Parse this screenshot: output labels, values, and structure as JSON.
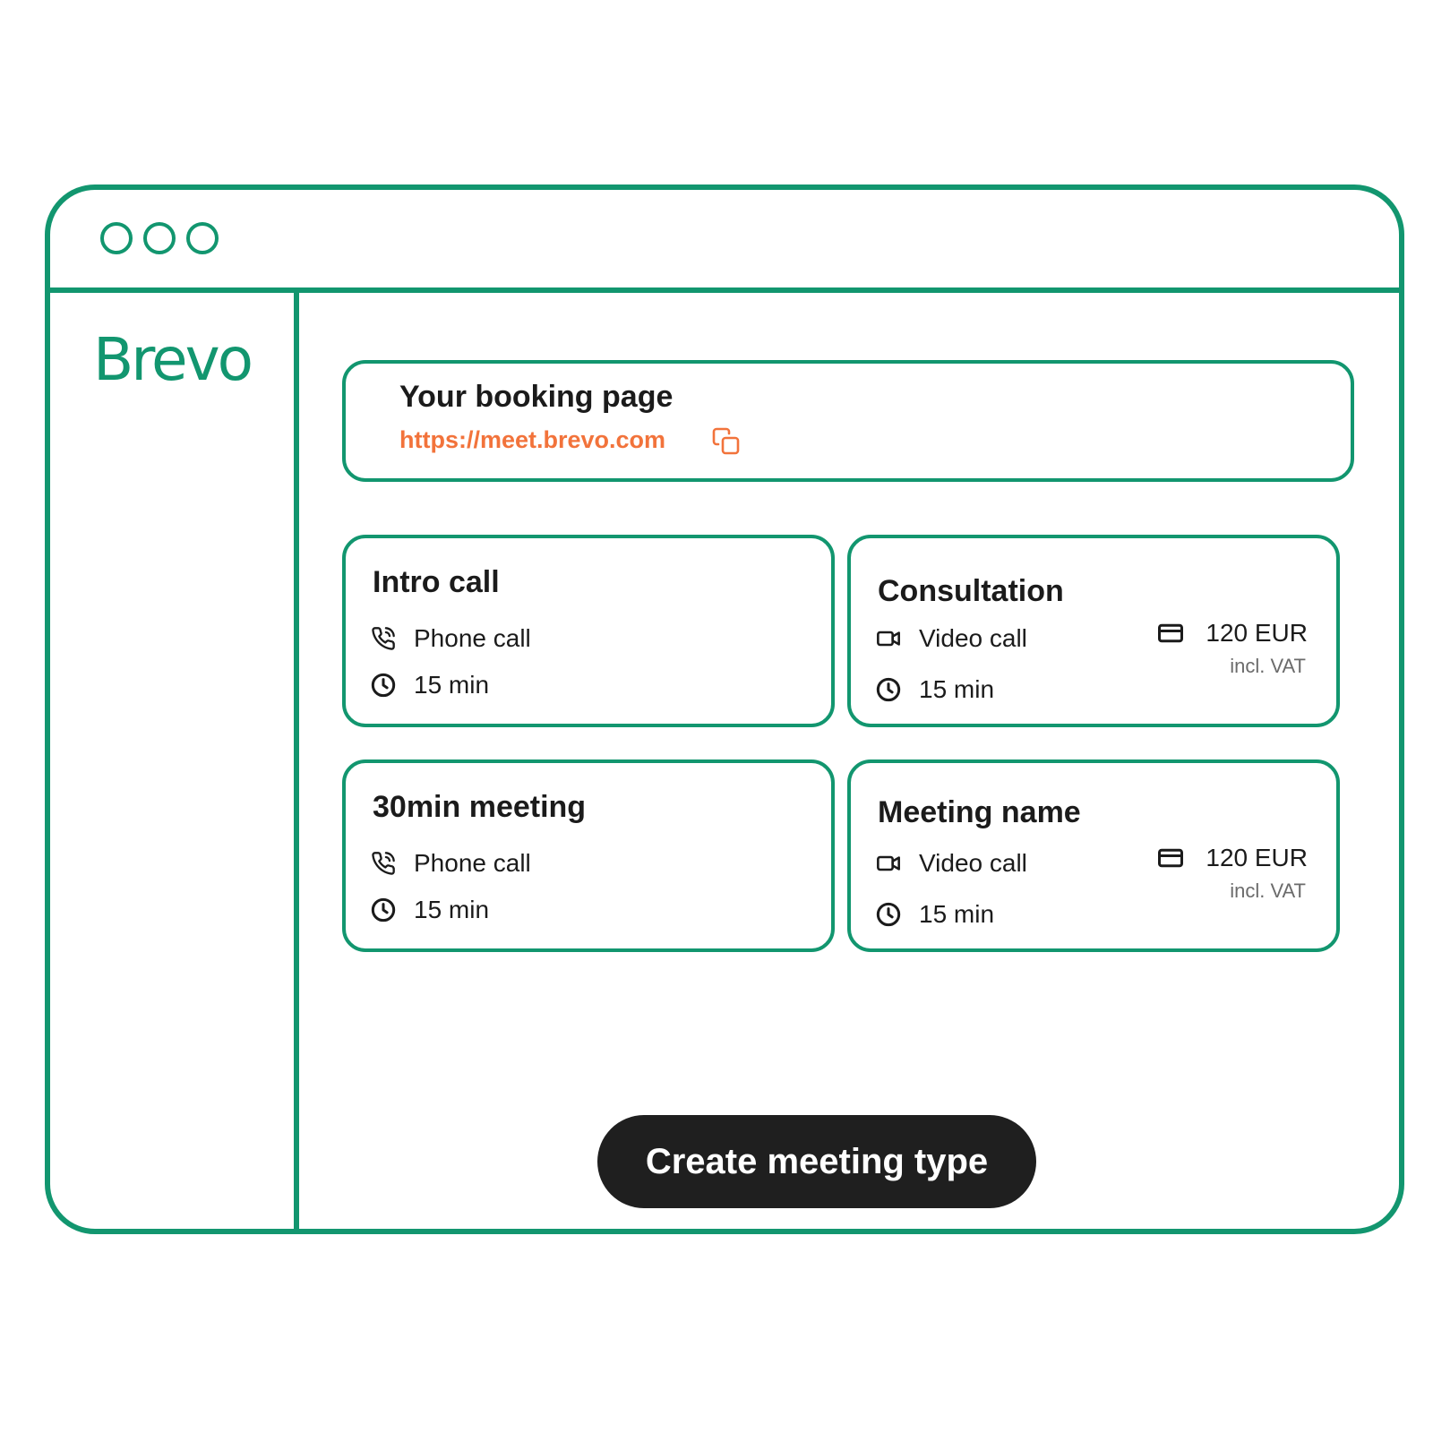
{
  "brand": {
    "name": "Brevo",
    "color": "#12966f"
  },
  "booking": {
    "title": "Your booking page",
    "url": "https://meet.brevo.com",
    "url_color": "#f2733b"
  },
  "meeting_types": [
    {
      "title": "Intro call",
      "location": "Phone call",
      "location_icon": "phone-icon",
      "duration": "15 min"
    },
    {
      "title": "Consultation",
      "location": "Video call",
      "location_icon": "video-camera-icon",
      "duration": "15 min",
      "price": "120 EUR",
      "price_note": "incl. VAT"
    },
    {
      "title": "30min meeting",
      "location": "Phone call",
      "location_icon": "phone-icon",
      "duration": "15 min"
    },
    {
      "title": "Meeting name",
      "location": "Video call",
      "location_icon": "video-camera-icon",
      "duration": "15 min",
      "price": "120 EUR",
      "price_note": "incl. VAT"
    }
  ],
  "cta": {
    "label": "Create meeting type"
  }
}
